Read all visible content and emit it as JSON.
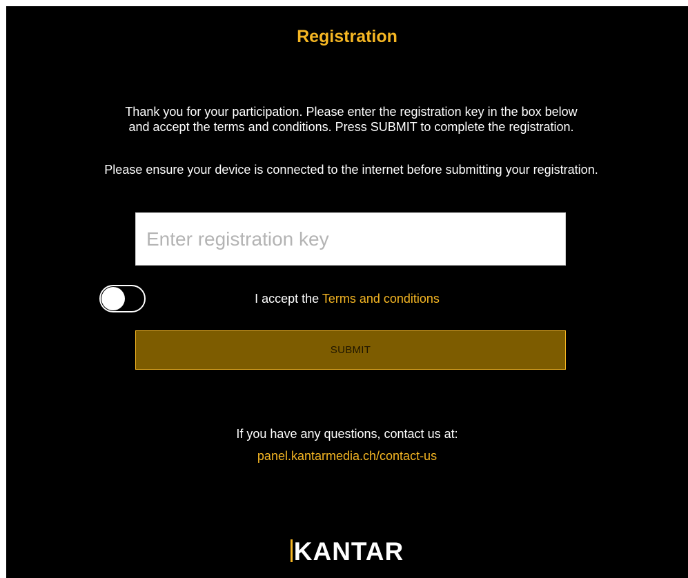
{
  "registration": {
    "title": "Registration",
    "intro": "Thank you for your participation. Please enter the registration key in the box below and accept the terms and conditions. Press SUBMIT to complete the registration.",
    "intro_internet": "Please ensure your device is connected to the internet before submitting your registration.",
    "key_field": {
      "placeholder": "Enter registration key",
      "value": ""
    },
    "terms": {
      "accepted": false,
      "prefix": "I accept the",
      "link_label": "Terms and conditions"
    },
    "submit_label": "SUBMIT",
    "contact": {
      "text": "If you have any questions, contact us at:",
      "link": "panel.kantarmedia.ch/contact-us"
    },
    "logo_text": "KANTAR"
  },
  "colors": {
    "background": "#000000",
    "accent": "#f5b623",
    "submit_fill": "#7d5c00",
    "text": "#ffffff"
  }
}
